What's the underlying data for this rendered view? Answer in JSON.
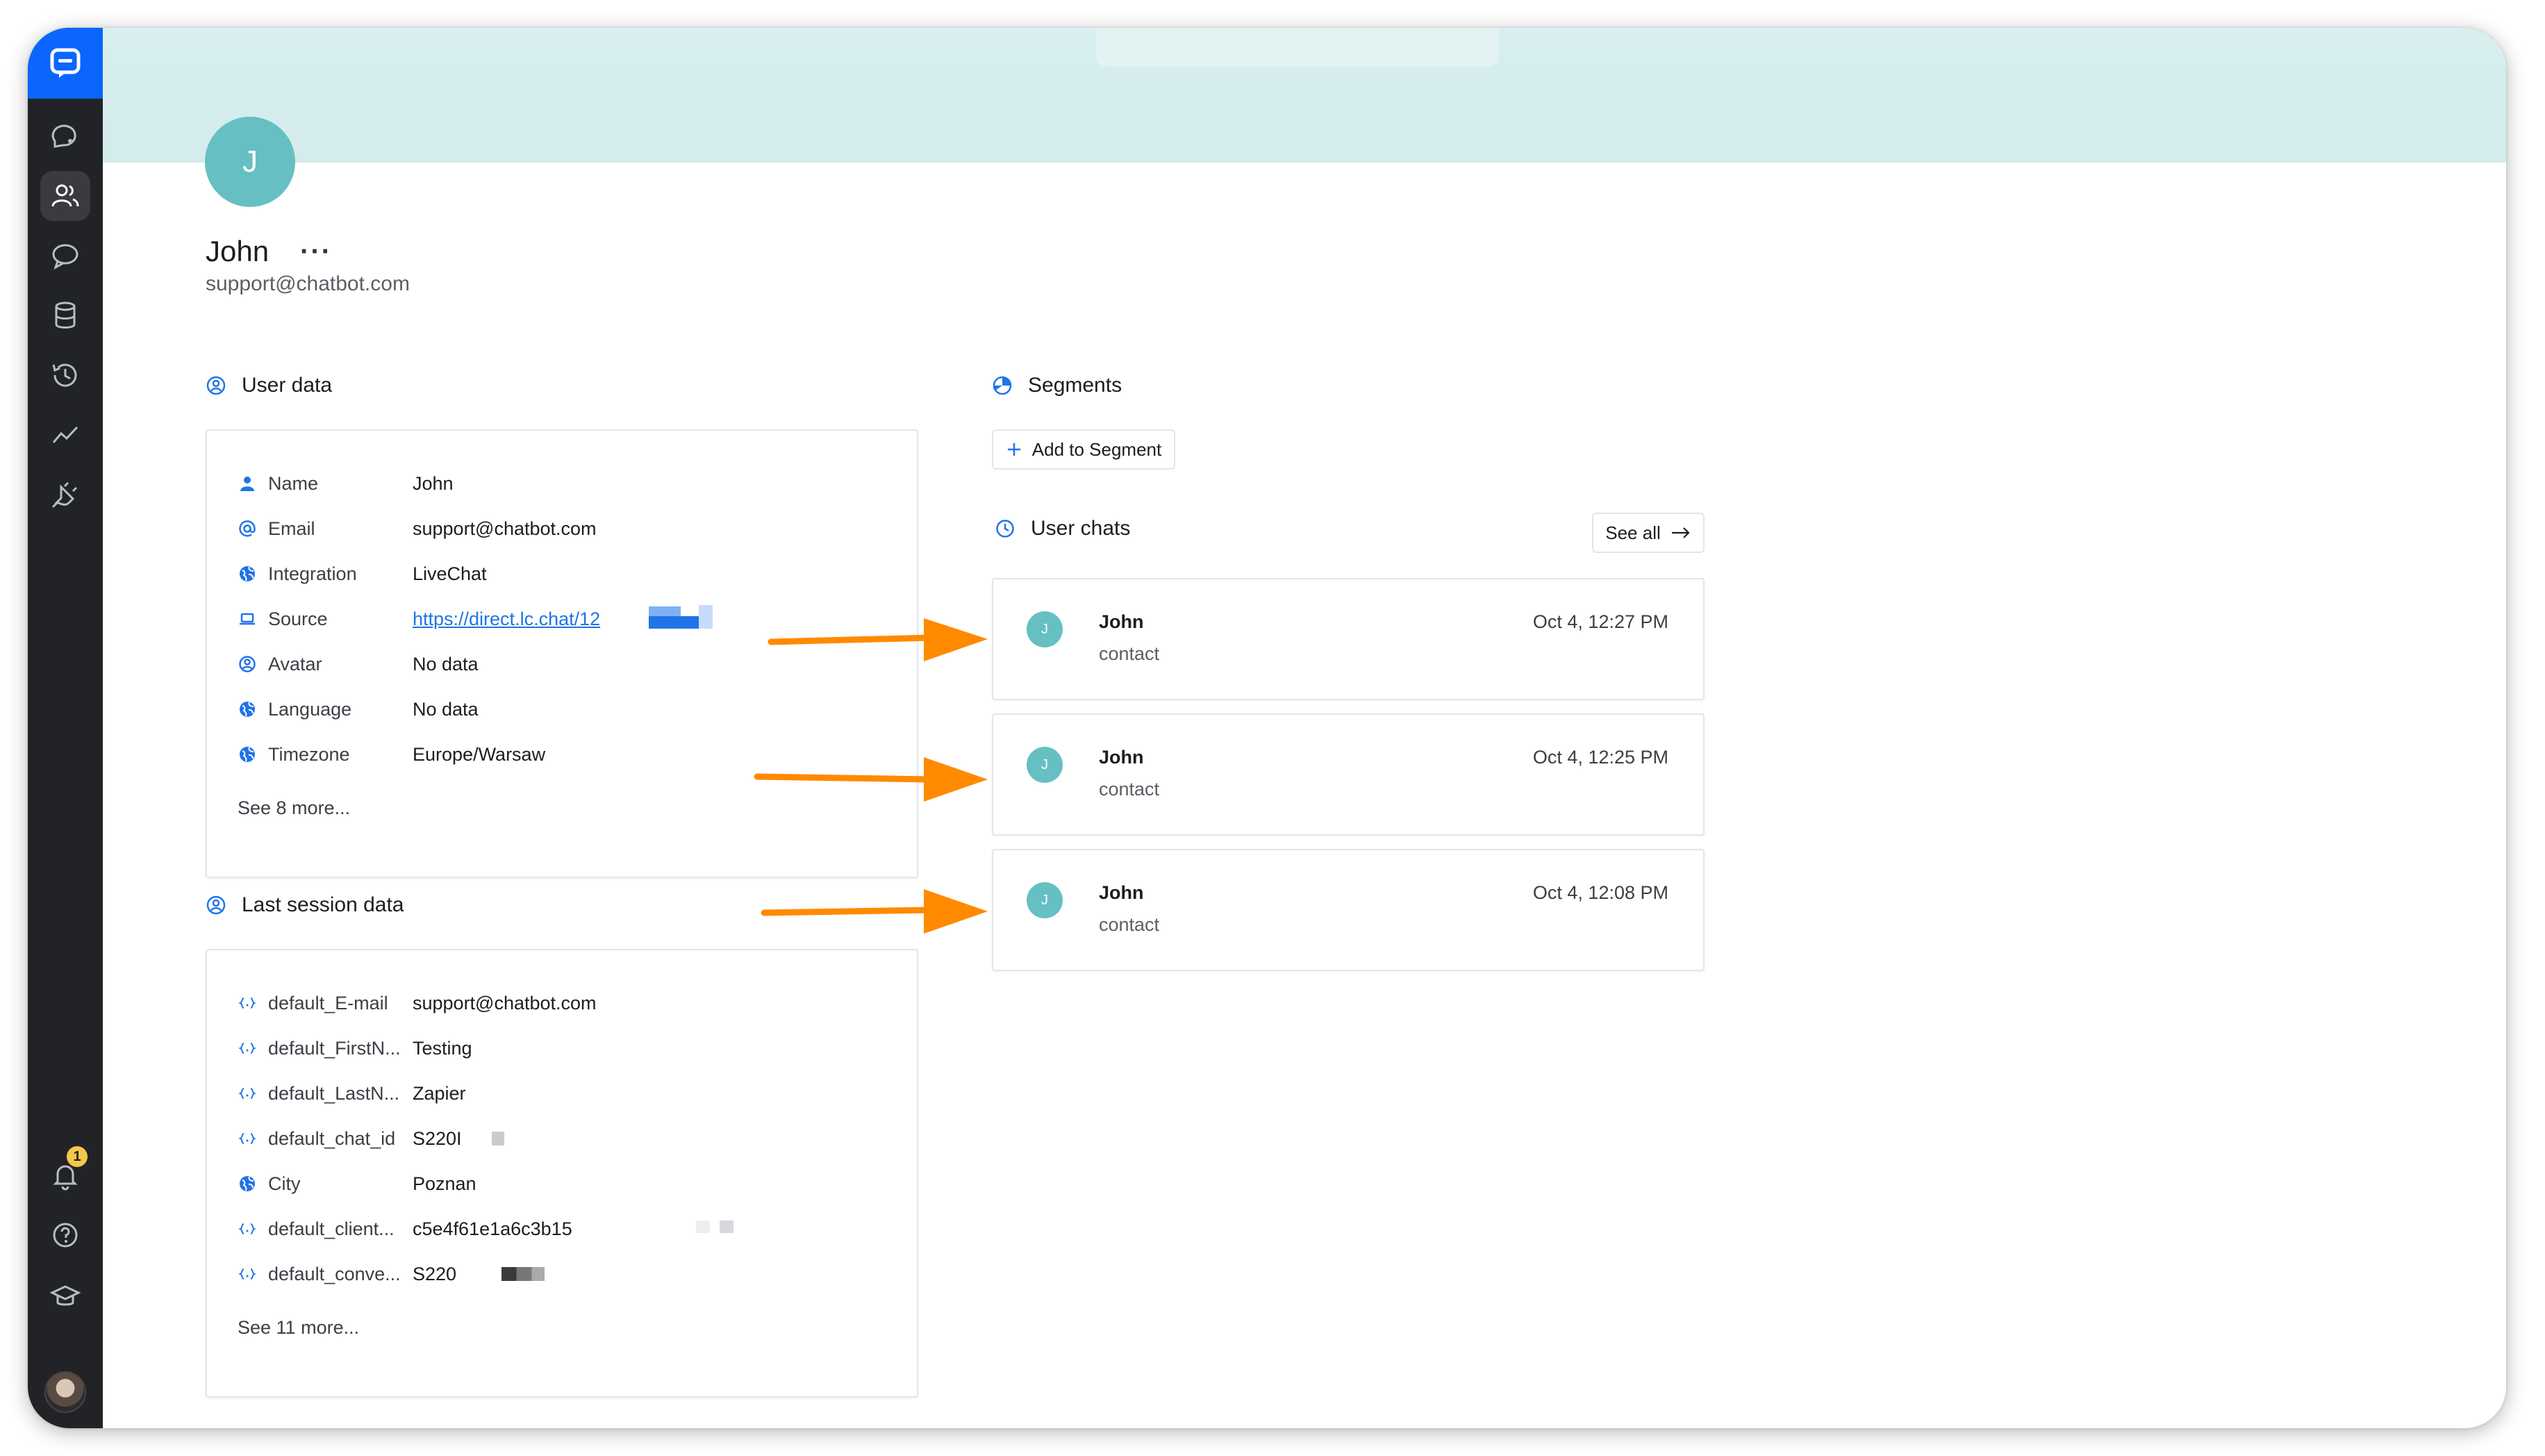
{
  "profile": {
    "initial": "J",
    "name": "John",
    "more": "···",
    "email": "support@chatbot.com"
  },
  "user_data": {
    "title": "User data",
    "rows": [
      {
        "icon": "person-icon",
        "label": "Name",
        "value": "John"
      },
      {
        "icon": "at-icon",
        "label": "Email",
        "value": "support@chatbot.com"
      },
      {
        "icon": "globe-icon",
        "label": "Integration",
        "value": "LiveChat"
      },
      {
        "icon": "laptop-icon",
        "label": "Source",
        "value": "https://direct.lc.chat/12"
      },
      {
        "icon": "user-circle-icon",
        "label": "Avatar",
        "value": "No data"
      },
      {
        "icon": "globe-icon",
        "label": "Language",
        "value": "No data"
      },
      {
        "icon": "globe-icon",
        "label": "Timezone",
        "value": "Europe/Warsaw"
      }
    ],
    "see_more": "See 8 more..."
  },
  "last_session": {
    "title": "Last session data",
    "rows": [
      {
        "icon": "braces-icon",
        "label": "default_E-mail",
        "value": "support@chatbot.com"
      },
      {
        "icon": "braces-icon",
        "label": "default_FirstN...",
        "value": "Testing"
      },
      {
        "icon": "braces-icon",
        "label": "default_LastN...",
        "value": "Zapier"
      },
      {
        "icon": "braces-icon",
        "label": "default_chat_id",
        "value": "S220I"
      },
      {
        "icon": "globe-icon",
        "label": "City",
        "value": "Poznan"
      },
      {
        "icon": "braces-icon",
        "label": "default_client...",
        "value": "c5e4f61e1a6c3b15"
      },
      {
        "icon": "braces-icon",
        "label": "default_conve...",
        "value": "S220"
      }
    ],
    "see_more": "See 11 more..."
  },
  "segments": {
    "title": "Segments",
    "add_label": "Add to Segment"
  },
  "user_chats": {
    "title": "User chats",
    "see_all": "See all",
    "chats": [
      {
        "initial": "J",
        "name": "John",
        "role": "contact",
        "time": "Oct 4, 12:27 PM"
      },
      {
        "initial": "J",
        "name": "John",
        "role": "contact",
        "time": "Oct 4, 12:25 PM"
      },
      {
        "initial": "J",
        "name": "John",
        "role": "contact",
        "time": "Oct 4, 12:08 PM"
      }
    ]
  },
  "sidebar": {
    "notification_count": "1",
    "items": [
      "chats-icon",
      "users-icon",
      "stories-icon",
      "database-icon",
      "history-icon",
      "reports-icon",
      "integrations-icon"
    ]
  },
  "colors": {
    "accent": "#0a66ff",
    "avatar": "#66bfc3",
    "arrow": "#ff8a00",
    "sidebar": "#222326"
  }
}
